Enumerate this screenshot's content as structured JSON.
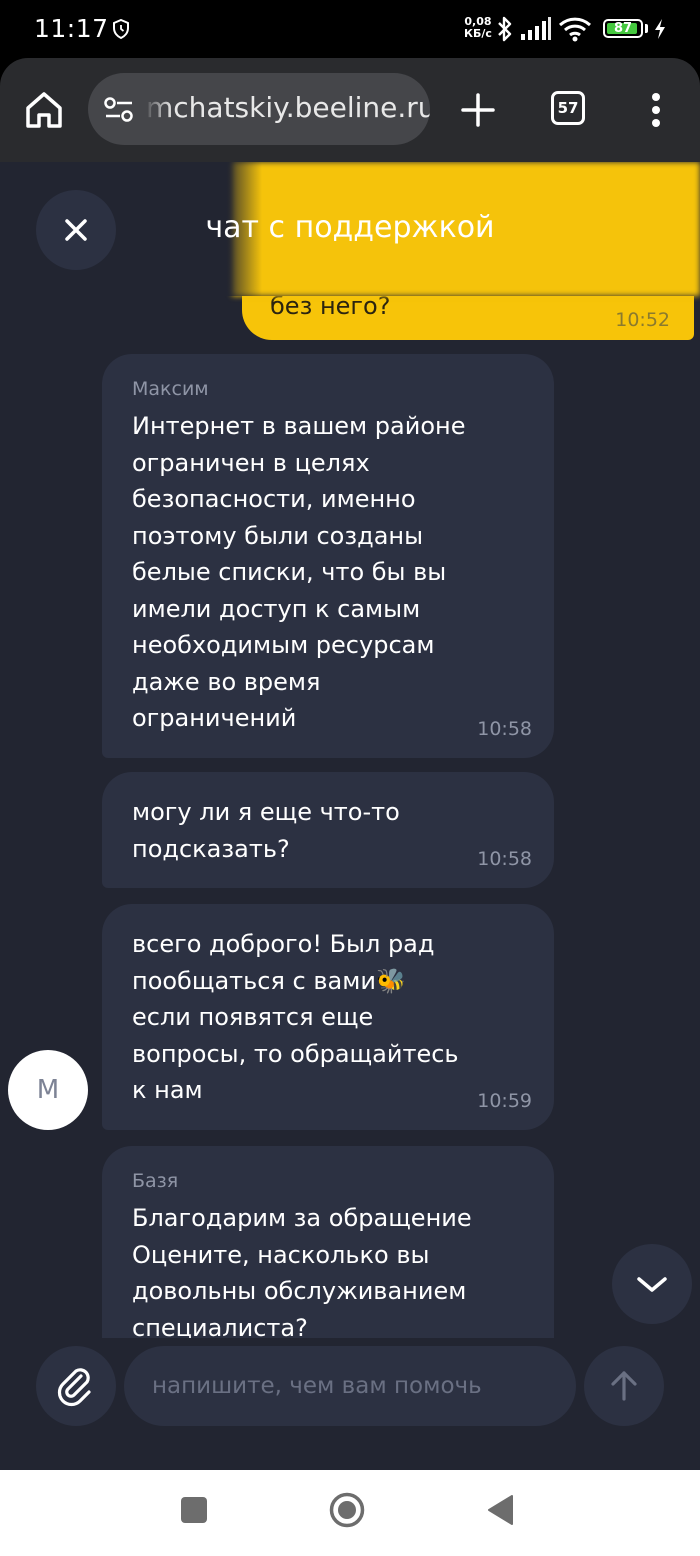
{
  "status_bar": {
    "time": "11:17",
    "net_speed_value": "0,08",
    "net_speed_unit": "КБ/с",
    "battery_level": "87"
  },
  "browser": {
    "url": "mchatskiy.beeline.ru",
    "tab_count": "57"
  },
  "chat": {
    "title": "чат с поддержкой",
    "outgoing_message": {
      "visible_text": "без него?",
      "time": "10:52"
    },
    "messages": [
      {
        "sender": "Максим",
        "text": "Интернет в вашем районе\nограничен в целях\nбезопасности, именно\nпоэтому были созданы\nбелые списки, что бы вы\nимели доступ к самым\nнеобходимым ресурсам\nдаже во время\nограничений",
        "time": "10:58"
      },
      {
        "text": "могу ли я еще что-то\nподсказать?",
        "time": "10:58"
      },
      {
        "text": "всего доброго! Был рад\nпообщаться с вами🐝\nесли появятся еще\nвопросы, то обращайтесь\nк нам",
        "time": "10:59"
      },
      {
        "sender": "Базя",
        "text": "Благодарим за обращение\nОцените, насколько вы\nдовольны обслуживанием\nспециалиста?"
      }
    ],
    "avatar_letter": "М",
    "composer_placeholder": "напишите, чем вам помочь"
  },
  "colors": {
    "chat_background": "#222531",
    "bubble": "#2c3142",
    "accent_yellow": "#f7c409",
    "browser_bar": "#2a2b2e"
  },
  "icons": {
    "status": [
      "shield-icon",
      "bluetooth-icon",
      "signal-icon",
      "wifi-icon",
      "battery-icon",
      "charging-icon"
    ],
    "browser": [
      "home-icon",
      "site-settings-icon",
      "plus-icon",
      "tabs-icon",
      "more-vert-icon"
    ],
    "chat": [
      "close-icon",
      "chevron-down-icon",
      "paperclip-icon",
      "arrow-up-icon"
    ],
    "nav": [
      "recents-icon",
      "home-circle-icon",
      "back-icon"
    ]
  }
}
